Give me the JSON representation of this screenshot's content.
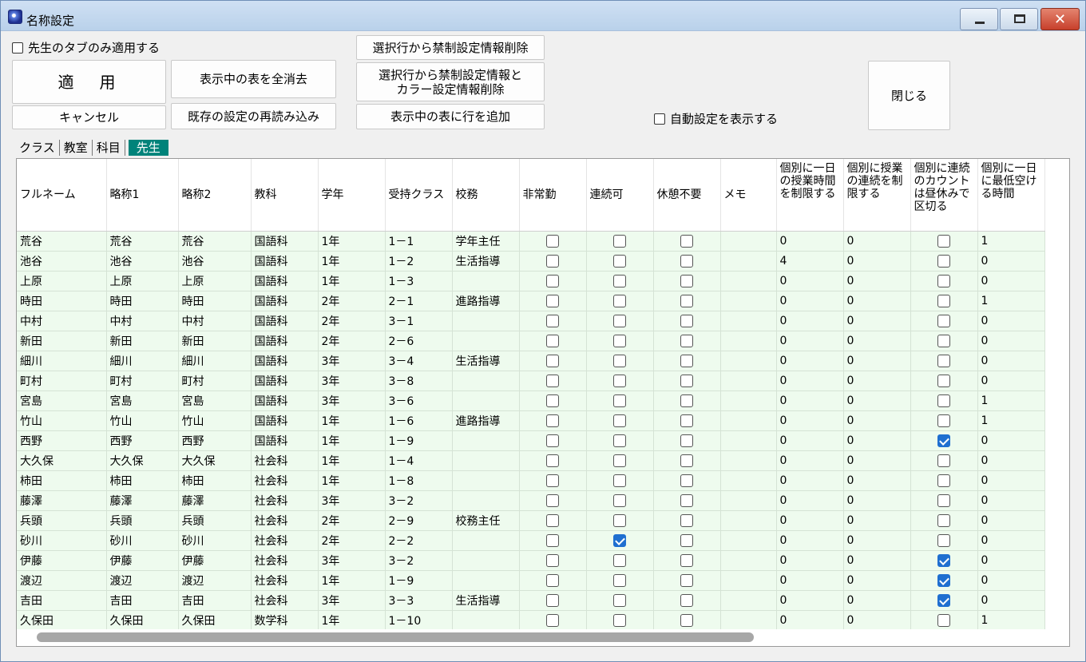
{
  "window": {
    "title": "名称設定",
    "controls": {
      "minimize": "minimize-icon",
      "maximize": "maximize-icon",
      "close": "✕"
    }
  },
  "toolbar": {
    "teacher_tab_only": "先生のタブのみ適用する",
    "apply": "適　用",
    "cancel": "キャンセル",
    "clear_all": "表示中の表を全消去",
    "reload": "既存の設定の再読み込み",
    "delete_forbid": "選択行から禁制設定情報削除",
    "delete_forbid_color_line1": "選択行から禁制設定情報と",
    "delete_forbid_color_line2": "カラー設定情報削除",
    "add_row": "表示中の表に行を追加",
    "show_auto": "自動設定を表示する",
    "close": "閉じる"
  },
  "tabs": [
    {
      "label": "クラス",
      "active": false
    },
    {
      "label": "教室",
      "active": false
    },
    {
      "label": "科目",
      "active": false
    },
    {
      "label": "先生",
      "active": true
    }
  ],
  "columns": [
    "フルネーム",
    "略称1",
    "略称2",
    "教科",
    "学年",
    "受持クラス",
    "校務",
    "非常勤",
    "連続可",
    "休憩不要",
    "メモ",
    "個別に一日の授業時間を制限する",
    "個別に授業の連続を制限する",
    "個別に連続のカウントは昼休みで区切る",
    "個別に一日に最低空ける時間"
  ],
  "rows": [
    [
      "荒谷",
      "荒谷",
      "荒谷",
      "国語科",
      "1年",
      "1－1",
      "学年主任",
      false,
      false,
      false,
      "",
      "0",
      "0",
      false,
      "1"
    ],
    [
      "池谷",
      "池谷",
      "池谷",
      "国語科",
      "1年",
      "1－2",
      "生活指導",
      false,
      false,
      false,
      "",
      "4",
      "0",
      false,
      "0"
    ],
    [
      "上原",
      "上原",
      "上原",
      "国語科",
      "1年",
      "1－3",
      "",
      false,
      false,
      false,
      "",
      "0",
      "0",
      false,
      "0"
    ],
    [
      "時田",
      "時田",
      "時田",
      "国語科",
      "2年",
      "2－1",
      "進路指導",
      false,
      false,
      false,
      "",
      "0",
      "0",
      false,
      "1"
    ],
    [
      "中村",
      "中村",
      "中村",
      "国語科",
      "2年",
      "3－1",
      "",
      false,
      false,
      false,
      "",
      "0",
      "0",
      false,
      "0"
    ],
    [
      "新田",
      "新田",
      "新田",
      "国語科",
      "2年",
      "2－6",
      "",
      false,
      false,
      false,
      "",
      "0",
      "0",
      false,
      "0"
    ],
    [
      "細川",
      "細川",
      "細川",
      "国語科",
      "3年",
      "3－4",
      "生活指導",
      false,
      false,
      false,
      "",
      "0",
      "0",
      false,
      "0"
    ],
    [
      "町村",
      "町村",
      "町村",
      "国語科",
      "3年",
      "3－8",
      "",
      false,
      false,
      false,
      "",
      "0",
      "0",
      false,
      "0"
    ],
    [
      "宮島",
      "宮島",
      "宮島",
      "国語科",
      "3年",
      "3－6",
      "",
      false,
      false,
      false,
      "",
      "0",
      "0",
      false,
      "1"
    ],
    [
      "竹山",
      "竹山",
      "竹山",
      "国語科",
      "1年",
      "1－6",
      "進路指導",
      false,
      false,
      false,
      "",
      "0",
      "0",
      false,
      "1"
    ],
    [
      "西野",
      "西野",
      "西野",
      "国語科",
      "1年",
      "1－9",
      "",
      false,
      false,
      false,
      "",
      "0",
      "0",
      true,
      "0"
    ],
    [
      "大久保",
      "大久保",
      "大久保",
      "社会科",
      "1年",
      "1－4",
      "",
      false,
      false,
      false,
      "",
      "0",
      "0",
      false,
      "0"
    ],
    [
      "柿田",
      "柿田",
      "柿田",
      "社会科",
      "1年",
      "1－8",
      "",
      false,
      false,
      false,
      "",
      "0",
      "0",
      false,
      "0"
    ],
    [
      "藤澤",
      "藤澤",
      "藤澤",
      "社会科",
      "3年",
      "3－2",
      "",
      false,
      false,
      false,
      "",
      "0",
      "0",
      false,
      "0"
    ],
    [
      "兵頭",
      "兵頭",
      "兵頭",
      "社会科",
      "2年",
      "2－9",
      "校務主任",
      false,
      false,
      false,
      "",
      "0",
      "0",
      false,
      "0"
    ],
    [
      "砂川",
      "砂川",
      "砂川",
      "社会科",
      "2年",
      "2－2",
      "",
      false,
      true,
      false,
      "",
      "0",
      "0",
      false,
      "0"
    ],
    [
      "伊藤",
      "伊藤",
      "伊藤",
      "社会科",
      "3年",
      "3－2",
      "",
      false,
      false,
      false,
      "",
      "0",
      "0",
      true,
      "0"
    ],
    [
      "渡辺",
      "渡辺",
      "渡辺",
      "社会科",
      "1年",
      "1－9",
      "",
      false,
      false,
      false,
      "",
      "0",
      "0",
      true,
      "0"
    ],
    [
      "吉田",
      "吉田",
      "吉田",
      "社会科",
      "3年",
      "3－3",
      "生活指導",
      false,
      false,
      false,
      "",
      "0",
      "0",
      true,
      "0"
    ],
    [
      "久保田",
      "久保田",
      "久保田",
      "数学科",
      "1年",
      "1－10",
      "",
      false,
      false,
      false,
      "",
      "0",
      "0",
      false,
      "1"
    ]
  ]
}
